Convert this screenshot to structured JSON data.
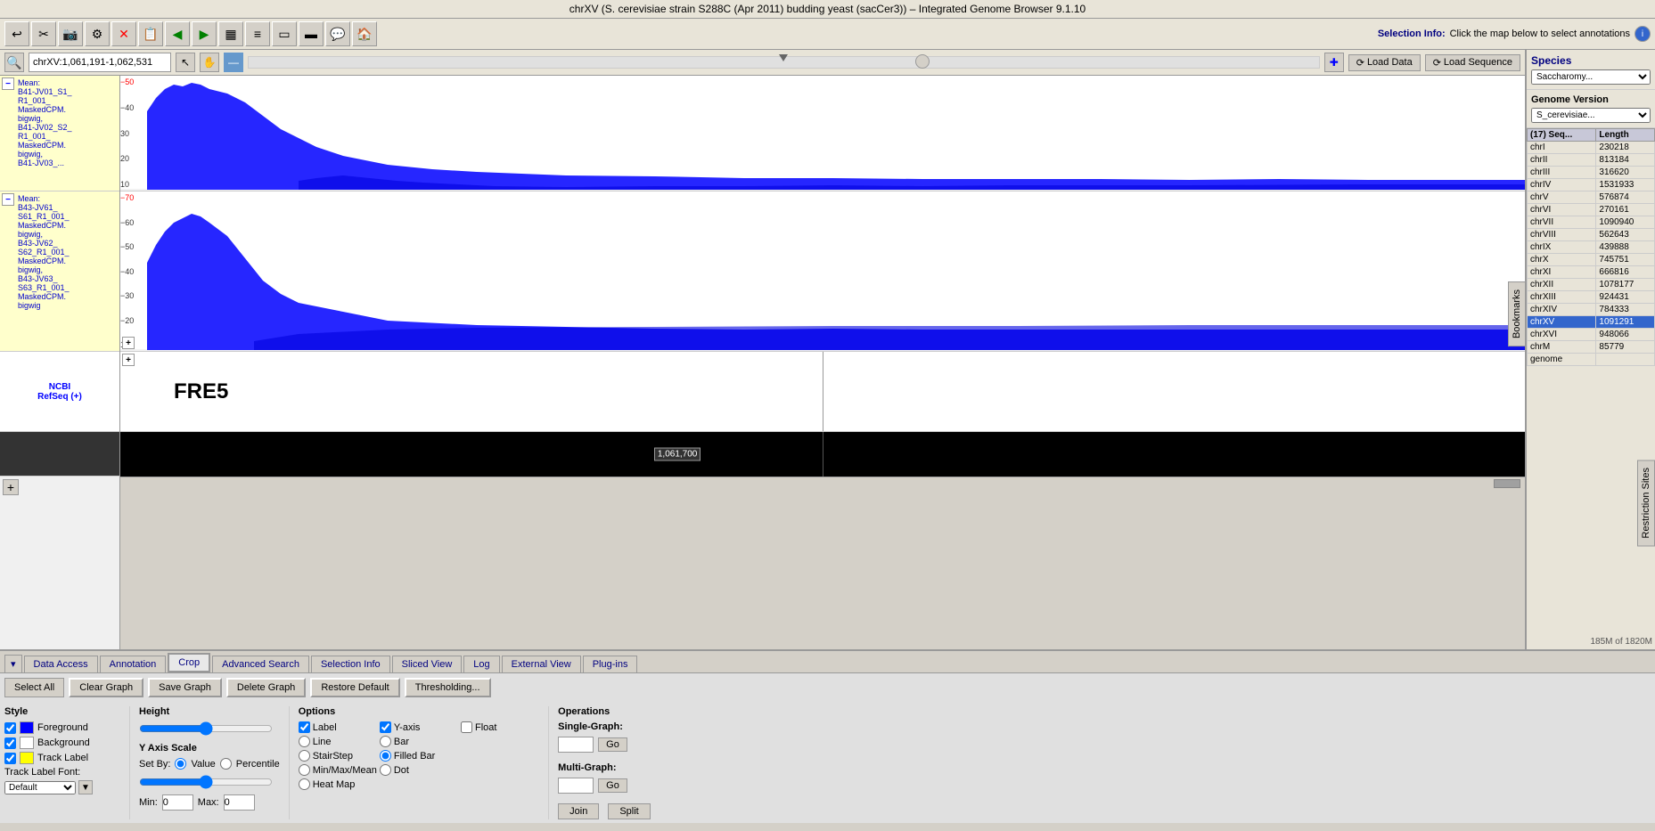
{
  "title": "chrXV  (S. cerevisiae strain S288C (Apr 2011) budding yeast (sacCer3)) – Integrated Genome Browser 9.1.10",
  "toolbar": {
    "buttons": [
      "⟲",
      "✂",
      "📷",
      "⚙",
      "✕",
      "📋",
      "◀",
      "▶",
      "▦",
      "≡",
      "▭",
      "▬",
      "💬",
      "🏠"
    ]
  },
  "selection_info": {
    "label": "Selection Info:",
    "text": "Click the map below to select annotations",
    "icon": "ℹ"
  },
  "nav": {
    "location": "chrXV:1,061,191-1,062,531",
    "zoom_position": "50%"
  },
  "tracks": [
    {
      "id": "track1",
      "label": "Mean:\nB41-JV01_S1_R1_001_MaskedCPM.bigwig,\nB41-JV02_S2_R1_001_MaskedCPM.bigwig,\nB41-JV03_...",
      "color": "#ffff00",
      "scale_max": 50,
      "scale_values": [
        50,
        40,
        30,
        20,
        10
      ]
    },
    {
      "id": "track2",
      "label": "Mean:\nB43-JV61_S61_R1_001_MaskedCPM.bigwig,\nB43-JV62_S62_R1_001_MaskedCPM.bigwig,\nB43-JV63_S63_R1_001_MaskedCPM.bigwig",
      "color": "#ffff00",
      "scale_max": 70,
      "scale_values": [
        70,
        60,
        50,
        40,
        30,
        20,
        10
      ]
    }
  ],
  "ncbi_refseq_label": "NCBI\nRefSeq (+)",
  "gene_name": "FRE5",
  "seq_position": "1,061,700",
  "right_panel": {
    "species_label": "Species",
    "species_value": "Saccharomy...",
    "genome_version_label": "Genome Version",
    "genome_version_value": "S_cerevisiae...",
    "seq_table_header": [
      "(17) Seq...",
      "Length"
    ],
    "sequences": [
      {
        "name": "chrI",
        "length": "230218"
      },
      {
        "name": "chrII",
        "length": "813184"
      },
      {
        "name": "chrIII",
        "length": "316620"
      },
      {
        "name": "chrIV",
        "length": "1531933"
      },
      {
        "name": "chrV",
        "length": "576874"
      },
      {
        "name": "chrVI",
        "length": "270161"
      },
      {
        "name": "chrVII",
        "length": "1090940"
      },
      {
        "name": "chrVIII",
        "length": "562643"
      },
      {
        "name": "chrIX",
        "length": "439888"
      },
      {
        "name": "chrX",
        "length": "745751"
      },
      {
        "name": "chrXI",
        "length": "666816"
      },
      {
        "name": "chrXII",
        "length": "1078177"
      },
      {
        "name": "chrXIII",
        "length": "924431"
      },
      {
        "name": "chrXIV",
        "length": "784333"
      },
      {
        "name": "chrXV",
        "length": "1091291",
        "selected": true
      },
      {
        "name": "chrXVI",
        "length": "948066"
      },
      {
        "name": "chrM",
        "length": "85779"
      },
      {
        "name": "genome",
        "length": ""
      }
    ]
  },
  "bottom_tabs": [
    {
      "label": "▾",
      "id": "dropdown"
    },
    {
      "label": "Data Access",
      "id": "data-access"
    },
    {
      "label": "Annotation",
      "id": "annotation"
    },
    {
      "label": "Crop",
      "id": "crop",
      "active": false,
      "special": true
    },
    {
      "label": "Advanced Search",
      "id": "advanced-search"
    },
    {
      "label": "Selection Info",
      "id": "selection-info"
    },
    {
      "label": "Sliced View",
      "id": "sliced-view"
    },
    {
      "label": "Log",
      "id": "log"
    },
    {
      "label": "External View",
      "id": "external-view"
    },
    {
      "label": "Plug-ins",
      "id": "plug-ins"
    }
  ],
  "bottom_content": {
    "action_buttons": {
      "select_all": "Select All",
      "clear_graph": "Clear Graph",
      "save_graph": "Save Graph",
      "delete_graph": "Delete Graph",
      "restore_default": "Restore Default",
      "thresholding": "Thresholding..."
    },
    "style": {
      "title": "Style",
      "foreground_label": "Foreground",
      "background_label": "Background",
      "track_label": "Track Label",
      "track_label_font": "Track Label Font:"
    },
    "height": {
      "title": "Height"
    },
    "y_axis_scale": {
      "title": "Y Axis Scale",
      "set_by": "Set By:",
      "value_label": "Value",
      "percentile_label": "Percentile",
      "min_label": "Min:",
      "min_value": "0",
      "max_label": "Max:",
      "max_value": "0"
    },
    "options": {
      "title": "Options",
      "label": "Label",
      "y_axis": "Y-axis",
      "float": "Float",
      "line": "Line",
      "bar": "Bar",
      "stair_step": "StairStep",
      "filled_bar": "Filled Bar",
      "min_max_mean": "Min/Max/Mean",
      "dot": "Dot",
      "heat_map": "Heat Map"
    },
    "operations": {
      "title": "Operations",
      "single_graph_label": "Single-Graph:",
      "go_label": "Go",
      "multi_graph_label": "Multi-Graph:",
      "go_label2": "Go",
      "join_label": "Join",
      "split_label": "Split"
    }
  },
  "bookmarks_tab": "Bookmarks",
  "restriction_tab": "Restriction Sites",
  "memory_bar": "185M of 1820M",
  "colors": {
    "accent_blue": "#3366cc",
    "track_blue": "#0000ff",
    "label_yellow": "#ffffcc",
    "navy": "#000080"
  }
}
